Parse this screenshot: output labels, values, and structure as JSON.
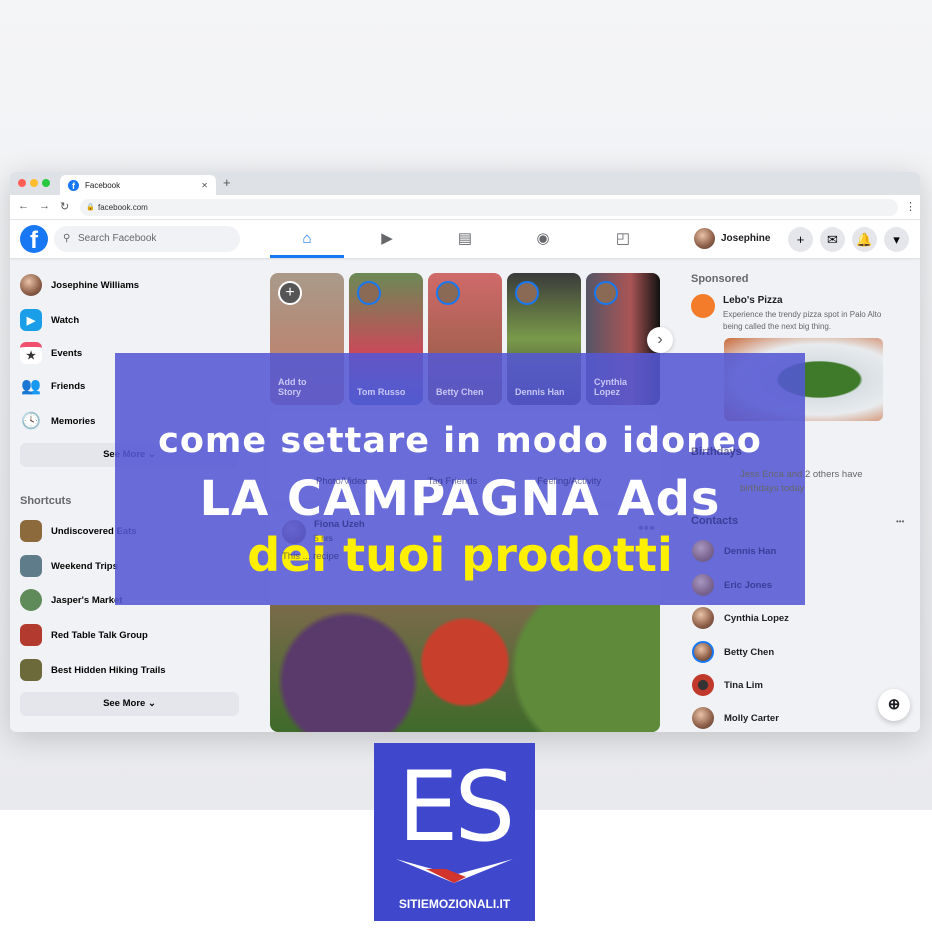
{
  "browser": {
    "tab_title": "Facebook",
    "url": "facebook.com"
  },
  "header": {
    "search_placeholder": "Search Facebook",
    "user_name": "Josephine"
  },
  "sidebar": {
    "items": [
      {
        "label": "Josephine Williams"
      },
      {
        "label": "Watch"
      },
      {
        "label": "Events"
      },
      {
        "label": "Friends"
      },
      {
        "label": "Memories"
      }
    ],
    "see_more": "See More",
    "shortcuts_title": "Shortcuts",
    "shortcuts": [
      {
        "label": "Undiscovered Eats"
      },
      {
        "label": "Weekend Trips"
      },
      {
        "label": "Jasper's Market"
      },
      {
        "label": "Red Table Talk Group"
      },
      {
        "label": "Best Hidden Hiking Trails"
      }
    ],
    "shortcuts_see_more": "See More"
  },
  "stories": [
    {
      "name": "Add to Story"
    },
    {
      "name": "Tom Russo"
    },
    {
      "name": "Betty Chen"
    },
    {
      "name": "Dennis Han"
    },
    {
      "name": "Cynthia Lopez"
    }
  ],
  "composer": {
    "actions": [
      "Photo/Video",
      "Tag Friends",
      "Feeling/Activity"
    ]
  },
  "post": {
    "author": "Fiona Uzeh",
    "time": "5 hrs",
    "text": "This ... recipe"
  },
  "right": {
    "sponsored_title": "Sponsored",
    "ad_name": "Lebo's Pizza",
    "ad_text": "Experience the trendy pizza spot in Palo Alto being called the next big thing.",
    "birthdays_title": "Birthdays",
    "birthday_text": "Jess Erica and 2 others have birthdays today",
    "contacts_title": "Contacts",
    "contacts": [
      "Dennis Han",
      "Eric Jones",
      "Cynthia Lopez",
      "Betty Chen",
      "Tina Lim",
      "Molly Carter"
    ]
  },
  "overlay": {
    "line1": "come settare in modo idoneo",
    "line2": "LA CAMPAGNA Ads",
    "line3": "dei tuoi prodotti"
  },
  "brand": {
    "logo_letters": "ES",
    "site": "SITIEMOZIONALI.IT",
    "color": "#3f48cc"
  },
  "colors": {
    "facebook_blue": "#1877f2",
    "overlay": "#5458d4",
    "highlight_yellow": "#ffef00"
  }
}
